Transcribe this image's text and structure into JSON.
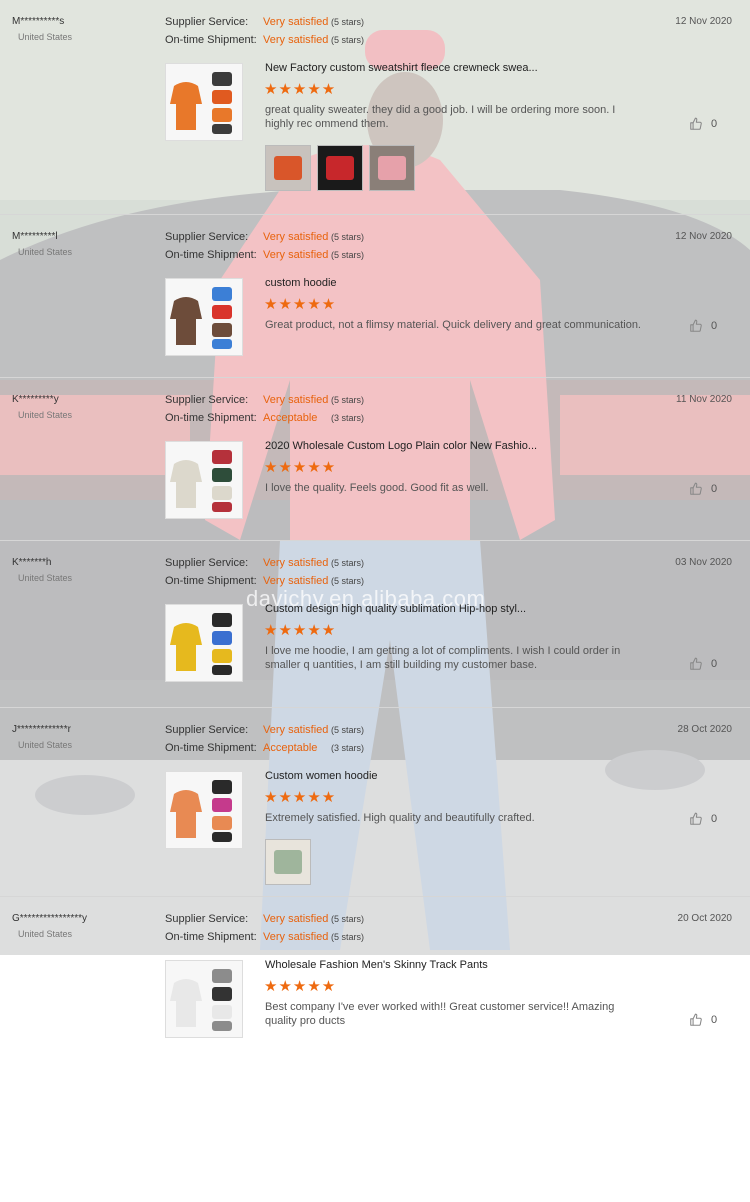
{
  "labels": {
    "supplier_service": "Supplier Service:",
    "ontime_shipment": "On-time Shipment:"
  },
  "watermark": "davichy.en.alibaba.com",
  "colors": {
    "accent": "#e8620d",
    "stars": "#ee6a10",
    "divider": "#d6d6d6"
  },
  "icons": {
    "like": "thumbs-up-icon",
    "star": "star-icon"
  },
  "reviews": [
    {
      "user": "M**********s",
      "country": "United States",
      "date": "12 Nov 2020",
      "supplier_value": "Very satisfied",
      "supplier_note": "(5 stars)",
      "shipment_value": "Very satisfied",
      "shipment_note": "(5 stars)",
      "product_title": "New Factory custom sweatshirt fleece crewneck swea...",
      "stars": "★★★★★",
      "star_count": 5,
      "text": "great quality sweater. they did a good job. I will be ordering more soon. I highly rec ommend them.",
      "likes": "0",
      "photo_count": 3
    },
    {
      "user": "M*********l",
      "country": "United States",
      "date": "12 Nov 2020",
      "supplier_value": "Very satisfied",
      "supplier_note": "(5 stars)",
      "shipment_value": "Very satisfied",
      "shipment_note": "(5 stars)",
      "product_title": "custom hoodie",
      "stars": "★★★★★",
      "star_count": 5,
      "text": "Great product, not a flimsy material. Quick delivery and great communication.",
      "likes": "0",
      "photo_count": 0
    },
    {
      "user": "K*********y",
      "country": "United States",
      "date": "11 Nov 2020",
      "supplier_value": "Very satisfied",
      "supplier_note": "(5 stars)",
      "shipment_value": "Acceptable",
      "shipment_note": "(3 stars)",
      "product_title": "2020 Wholesale Custom Logo Plain color New Fashio...",
      "stars": "★★★★★",
      "star_count": 5,
      "text": "I love the quality. Feels good. Good fit as well.",
      "likes": "0",
      "photo_count": 0
    },
    {
      "user": "K*******h",
      "country": "United States",
      "date": "03 Nov 2020",
      "supplier_value": "Very satisfied",
      "supplier_note": "(5 stars)",
      "shipment_value": "Very satisfied",
      "shipment_note": "(5 stars)",
      "product_title": "Custom design high quality sublimation Hip-hop styl...",
      "stars": "★★★★★",
      "star_count": 5,
      "text": "I love me hoodie, I am getting a lot of compliments. I wish I could order in smaller q uantities, I am still building my customer base.",
      "likes": "0",
      "photo_count": 0
    },
    {
      "user": "J*************r",
      "country": "United States",
      "date": "28 Oct 2020",
      "supplier_value": "Very satisfied",
      "supplier_note": "(5 stars)",
      "shipment_value": "Acceptable",
      "shipment_note": "(3 stars)",
      "product_title": "Custom women hoodie",
      "stars": "★★★★★",
      "star_count": 5,
      "text": "Extremely satisfied. High quality and beautifully crafted.",
      "likes": "0",
      "photo_count": 1
    },
    {
      "user": "G****************y",
      "country": "United States",
      "date": "20 Oct 2020",
      "supplier_value": "Very satisfied",
      "supplier_note": "(5 stars)",
      "shipment_value": "Very satisfied",
      "shipment_note": "(5 stars)",
      "product_title": "Wholesale Fashion Men's Skinny Track Pants",
      "stars": "★★★★★",
      "star_count": 5,
      "text": "Best company I've ever worked with!! Great customer service!! Amazing quality pro ducts",
      "likes": "0",
      "photo_count": 0
    }
  ]
}
